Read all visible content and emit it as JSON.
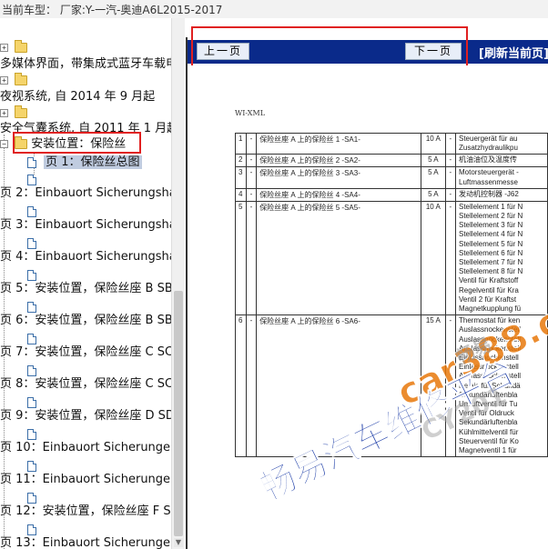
{
  "header": {
    "title": "当前车型： 厂家:Y-一汽-奥迪A6L2015-2017"
  },
  "tree": {
    "items": [
      {
        "label": "多媒体界面，带集成式蓝牙车载电"
      },
      {
        "label": "夜视系统, 自 2014 年 9 月起"
      },
      {
        "label": "安全气囊系统, 自 2011 年 1 月起"
      },
      {
        "label": "安装位置：保险丝"
      },
      {
        "label": "页 1：保险丝总图"
      },
      {
        "label": "页 2：Einbauort Sicherungshal"
      },
      {
        "label": "页 3：Einbauort Sicherungshal"
      },
      {
        "label": "页 4：Einbauort Sicherungshal"
      },
      {
        "label": "页 5：安装位置，保险丝座 B SB"
      },
      {
        "label": "页 6：安装位置，保险丝座 B SB"
      },
      {
        "label": "页 7：安装位置，保险丝座 C SC"
      },
      {
        "label": "页 8：安装位置，保险丝座 C SC"
      },
      {
        "label": "页 9：安装位置，保险丝座 D SD"
      },
      {
        "label": "页 10：Einbauort Sicherungen"
      },
      {
        "label": "页 11：Einbauort Sicherungen"
      },
      {
        "label": "页 12：安装位置，保险丝座 F SF"
      },
      {
        "label": "页 13：Einbauort Sicherungen"
      }
    ]
  },
  "nav": {
    "prev": "上一页",
    "next": "下一页",
    "refresh": "[刷新当前页]"
  },
  "doc": {
    "header": "WI-XML",
    "rows": [
      {
        "no": "1",
        "dash": "-",
        "desc": "保险丝座 A 上的保险丝 1 -SA1-",
        "amp": "10 A",
        "dash2": "-",
        "func": [
          "Steuergerät für au",
          "Zusatzhydraulikpu"
        ]
      },
      {
        "no": "2",
        "dash": "-",
        "desc": "保险丝座 A 上的保险丝 2 -SA2-",
        "amp": "5 A",
        "dash2": "-",
        "func": [
          "机油油位及温度传"
        ]
      },
      {
        "no": "3",
        "dash": "-",
        "desc": "保险丝座 A 上的保险丝 3 -SA3-",
        "amp": "5 A",
        "dash2": "-",
        "func": [
          "Motorsteuergerät -",
          "Luftmassenmesse"
        ]
      },
      {
        "no": "4",
        "dash": "-",
        "desc": "保险丝座 A 上的保险丝 4 -SA4-",
        "amp": "5 A",
        "dash2": "-",
        "func": [
          "发动机控制器 -J62"
        ]
      },
      {
        "no": "5",
        "dash": "-",
        "desc": "保险丝座 A 上的保险丝 5 -SA5-",
        "amp": "10 A",
        "dash2": "-",
        "func": [
          "Stellelement 1 für N",
          "Stellelement 2 für N",
          "Stellelement 3 für N",
          "Stellelement 4 für N",
          "Stellelement 5 für N",
          "Stellelement 6 für N",
          "Stellelement 7 für N",
          "Stellelement 8 für N",
          "Ventil für Kraftstoff",
          "Regelventil für Kra",
          "Ventil 2 für Kraftst",
          "Magnetkupplung fü"
        ]
      },
      {
        "no": "6",
        "dash": "-",
        "desc": "保险丝座 A 上的保险丝 6 -SA6-",
        "amp": "15 A",
        "dash2": "-",
        "func": [
          "Thermostat für ken",
          "Auslassnockenstell",
          "Auslassnockenstell",
          "Auslassnockenstell",
          "Einlassnockenstell",
          "Einlassnockenstell",
          "Auslassnockenstell",
          "Relais für Sekundä",
          "Sekundärluftenbla",
          "Umluftventil für Tu",
          "Ventil für Oldruck",
          "Sekundärluftenbla",
          "Kühlmittelventil für",
          "Steuerventil für Ko",
          "Magnetventil 1 für"
        ]
      }
    ]
  },
  "watermark": {
    "brand": "car388.com",
    "slogan": "畅易汽车维修平台",
    "small": "畅易",
    "code": "CY201"
  }
}
